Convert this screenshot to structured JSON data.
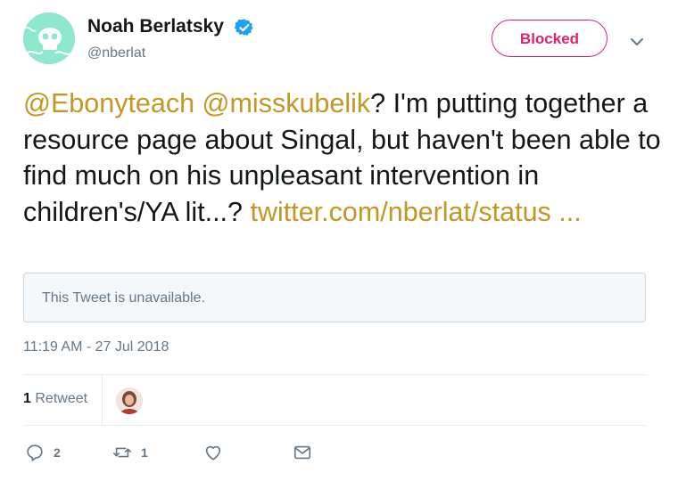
{
  "user": {
    "name": "Noah Berlatsky",
    "handle": "@nberlat",
    "verified": true
  },
  "follow_button": {
    "label": "Blocked",
    "color": "#e0245e"
  },
  "tweet": {
    "mention_1": "@Ebonyteach",
    "mention_2": "@misskubelik",
    "text_1": "? I'm putting together a resource page about Singal, but haven't been able to find much on his unpleasant intervention in children's/YA lit...?",
    "link": "twitter.com/nberlat/status ...",
    "link_color": "#c39724"
  },
  "quoted_tweet": {
    "text": "This Tweet is unavailable."
  },
  "timestamp": "11:19 AM - 27 Jul 2018",
  "stats": {
    "retweet_count": "1",
    "retweet_label": "Retweet"
  },
  "actions": {
    "reply_count": "2",
    "retweet_count": "1",
    "like_icon": "heart-icon",
    "dm_icon": "envelope-icon"
  }
}
